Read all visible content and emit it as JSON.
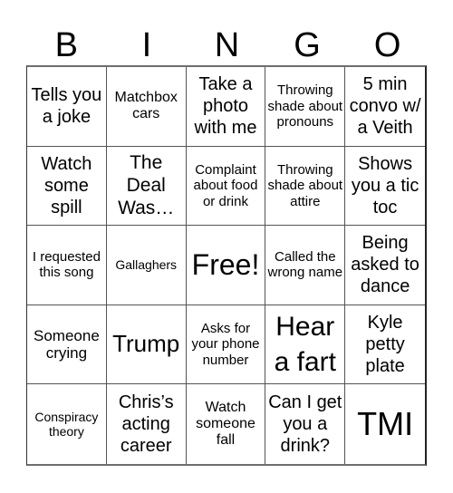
{
  "header": {
    "letters": [
      "B",
      "I",
      "N",
      "G",
      "O"
    ]
  },
  "cells": [
    "Tells you a joke",
    "Matchbox cars",
    "Take a photo with me",
    "Throwing shade about pronouns",
    "5 min convo w/ a Veith",
    "Watch some spill",
    "The Deal Was…",
    "Complaint about food or drink",
    "Throwing shade about attire",
    "Shows you a tic toc",
    "I requested this song",
    "Gallaghers",
    "Free!",
    "Called the wrong name",
    "Being asked to dance",
    "Someone crying",
    "Trump",
    "Asks for your phone number",
    "Hear a fart",
    "Kyle petty plate",
    "Conspiracy theory",
    "Chris’s acting career",
    "Watch someone fall",
    "Can I get you a drink?",
    "TMI"
  ]
}
